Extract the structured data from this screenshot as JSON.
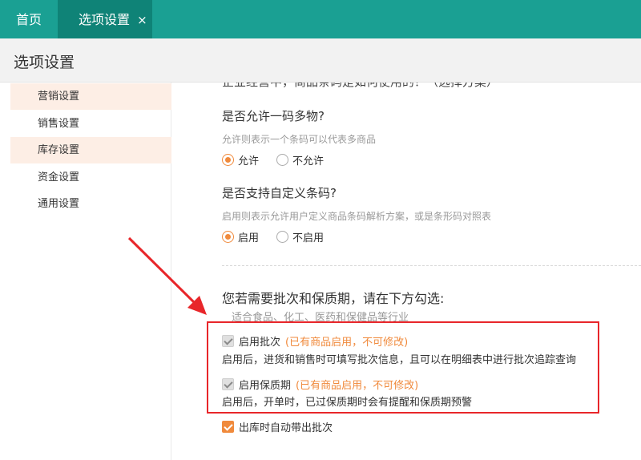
{
  "tabs": {
    "home": "首页",
    "active": "选项设置",
    "close": "×"
  },
  "page_title": "选项设置",
  "sidebar": {
    "items": [
      {
        "label": "营销设置"
      },
      {
        "label": "销售设置"
      },
      {
        "label": "库存设置"
      },
      {
        "label": "资金设置"
      },
      {
        "label": "通用设置"
      }
    ]
  },
  "content": {
    "cut_off_text": "企业经营中，商品条码是如何使用的？（选择方案）",
    "multi_code": {
      "question": "是否允许一码多物?",
      "hint": "允许则表示一个条码可以代表多商品",
      "options": [
        "允许",
        "不允许"
      ],
      "selected": "允许"
    },
    "custom_code": {
      "question": "是否支持自定义条码?",
      "hint": "启用则表示允许用户定义商品条码解析方案，或是条形码对照表",
      "options": [
        "启用",
        "不启用"
      ],
      "selected": "启用"
    },
    "batch_section": {
      "title": "您若需要批次和保质期，请在下方勾选:",
      "subtitle": "适合食品、化工、医药和保健品等行业",
      "batch": {
        "label": "启用批次",
        "note": "(已有商品启用，不可修改)",
        "desc": "启用后，进货和销售时可填写批次信息，且可以在明细表中进行批次追踪查询",
        "checked": true
      },
      "expiry": {
        "label": "启用保质期",
        "note": "(已有商品启用，不可修改)",
        "desc": "启用后，开单时，已过保质期时会有提醒和保质期预警",
        "checked": true
      },
      "auto_batch": {
        "label": "出库时自动带出批次",
        "checked": true
      }
    }
  },
  "colors": {
    "tab_bar": "#1aa093",
    "tab_active": "#0f8377",
    "accent": "#f08a3c",
    "annotation": "#e8262a",
    "sidebar_highlight": "#fdeee5"
  }
}
